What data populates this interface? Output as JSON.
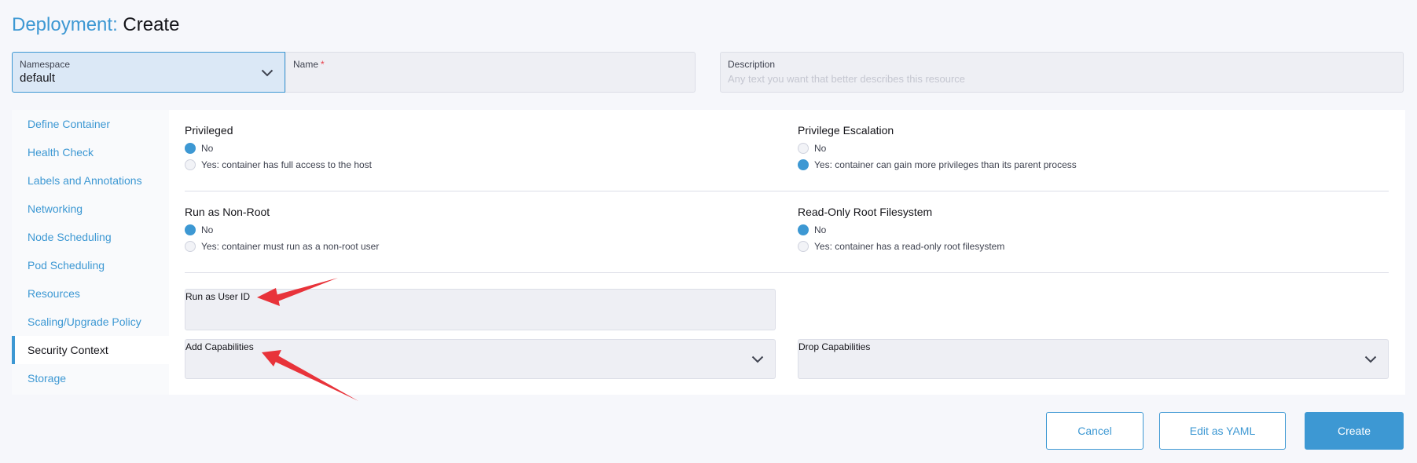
{
  "header": {
    "resource_type": "Deployment:",
    "action": "Create"
  },
  "namespace": {
    "label": "Namespace",
    "value": "default"
  },
  "name_field": {
    "label": "Name",
    "required_mark": "*",
    "value": ""
  },
  "description_field": {
    "label": "Description",
    "placeholder": "Any text you want that better describes this resource"
  },
  "sidebar": {
    "items": [
      {
        "label": "Define Container",
        "active": false
      },
      {
        "label": "Health Check",
        "active": false
      },
      {
        "label": "Labels and Annotations",
        "active": false
      },
      {
        "label": "Networking",
        "active": false
      },
      {
        "label": "Node Scheduling",
        "active": false
      },
      {
        "label": "Pod Scheduling",
        "active": false
      },
      {
        "label": "Resources",
        "active": false
      },
      {
        "label": "Scaling/Upgrade Policy",
        "active": false
      },
      {
        "label": "Security Context",
        "active": true
      },
      {
        "label": "Storage",
        "active": false
      }
    ]
  },
  "security": {
    "privileged": {
      "title": "Privileged",
      "options": [
        {
          "label": "No",
          "checked": true
        },
        {
          "label": "Yes: container has full access to the host",
          "checked": false
        }
      ]
    },
    "privilege_escalation": {
      "title": "Privilege Escalation",
      "options": [
        {
          "label": "No",
          "checked": false
        },
        {
          "label": "Yes: container can gain more privileges than its parent process",
          "checked": true
        }
      ]
    },
    "run_as_non_root": {
      "title": "Run as Non-Root",
      "options": [
        {
          "label": "No",
          "checked": true
        },
        {
          "label": "Yes: container must run as a non-root user",
          "checked": false
        }
      ]
    },
    "read_only_root_fs": {
      "title": "Read-Only Root Filesystem",
      "options": [
        {
          "label": "No",
          "checked": true
        },
        {
          "label": "Yes: container has a read-only root filesystem",
          "checked": false
        }
      ]
    },
    "run_as_user_id": {
      "label": "Run as User ID",
      "value": ""
    },
    "add_capabilities": {
      "label": "Add Capabilities"
    },
    "drop_capabilities": {
      "label": "Drop Capabilities"
    }
  },
  "footer": {
    "cancel_label": "Cancel",
    "edit_yaml_label": "Edit as YAML",
    "create_label": "Create"
  },
  "colors": {
    "accent": "#3d98d3",
    "annotation_arrow": "#e8333a",
    "required": "#e8424d"
  },
  "icons": {
    "dropdown": "chevron-down-icon"
  }
}
